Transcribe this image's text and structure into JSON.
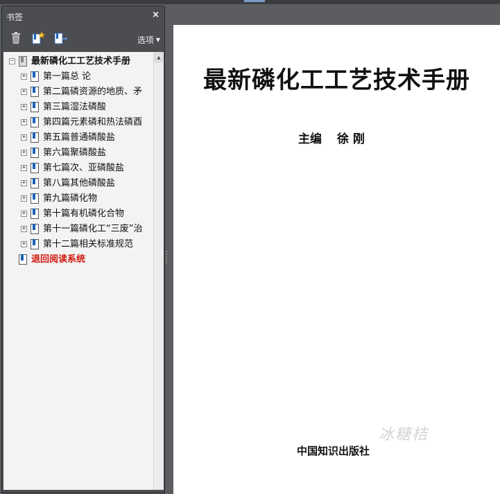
{
  "bookmarks_panel": {
    "title": "书签",
    "close_glyph": "×",
    "options_label": "选项",
    "tools": [
      "delete-bookmark-icon",
      "new-bookmark-icon",
      "bookmark-from-selection-icon"
    ],
    "root": "最新磷化工工艺技术手册",
    "items": [
      "第一篇总 论",
      "第二篇磷资源的地质、矛",
      "第三篇湿法磷酸",
      "第四篇元素磷和热法磷酉",
      "第五篇普通磷酸盐",
      "第六篇聚磷酸盐",
      "第七篇次、亚磷酸盐",
      "第八篇其他磷酸盐",
      "第九篇磷化物",
      "第十篇有机磷化合物",
      "第十一篇磷化工“三废”治",
      "第十二篇相关标准规范"
    ],
    "return_link": "退回阅读系统"
  },
  "document": {
    "title": "最新磷化工工艺技术手册",
    "editor_label": "主编",
    "editor_name": "徐  刚",
    "publisher": "中国知识出版社",
    "watermark": "冰糖桔"
  },
  "colors": {
    "return_link": "#d21a0f",
    "bookmark_icon": "#1a62b8",
    "panel_bg": "#4b4d51"
  }
}
